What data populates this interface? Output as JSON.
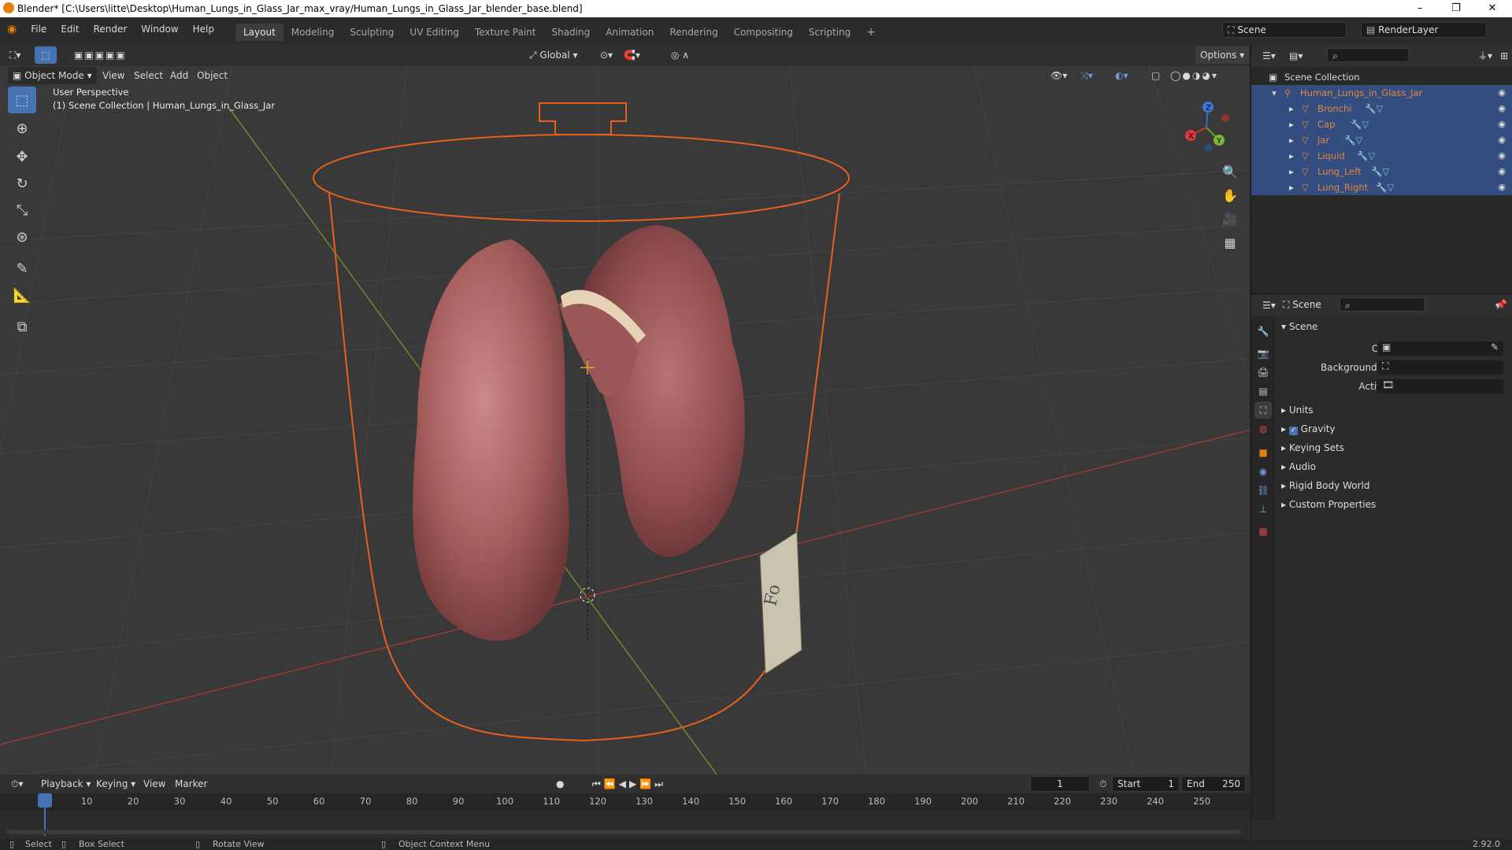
{
  "window": {
    "title": "Blender* [C:\\Users\\litte\\Desktop\\Human_Lungs_in_Glass_Jar_max_vray/Human_Lungs_in_Glass_Jar_blender_base.blend]",
    "minimize": "–",
    "maximize": "❐",
    "close": "✕"
  },
  "menu": {
    "items": [
      "File",
      "Edit",
      "Render",
      "Window",
      "Help"
    ],
    "workspaces": [
      "Layout",
      "Modeling",
      "Sculpting",
      "UV Editing",
      "Texture Paint",
      "Shading",
      "Animation",
      "Rendering",
      "Compositing",
      "Scripting"
    ],
    "add_workspace": "+",
    "scene_name": "Scene",
    "render_layer": "RenderLayer"
  },
  "viewport": {
    "mode": "Object Mode",
    "header_menus": [
      "View",
      "Select",
      "Add",
      "Object"
    ],
    "transform_orientation": "Global",
    "options_label": "Options",
    "overlay_line1": "User Perspective",
    "overlay_line2": "(1) Scene Collection | Human_Lungs_in_Glass_Jar",
    "gizmo_x": "X",
    "gizmo_y": "Y",
    "gizmo_z": "Z",
    "label_text": "Fo"
  },
  "outliner": {
    "root": "Scene Collection",
    "collection": "Human_Lungs_in_Glass_Jar",
    "objects": [
      "Bronchi",
      "Cap",
      "Jar",
      "Liquid",
      "Lung_Left",
      "Lung_Right"
    ]
  },
  "properties": {
    "context": "Scene",
    "panel": "Scene",
    "camera_label": "Camera",
    "background_label": "Background Scene",
    "clip_label": "Active Clip",
    "sections": [
      "Units",
      "Gravity",
      "Keying Sets",
      "Audio",
      "Rigid Body World",
      "Custom Properties"
    ],
    "gravity_checked": true
  },
  "timeline": {
    "menus": [
      "Playback",
      "Keying",
      "View",
      "Marker"
    ],
    "current_frame": "1",
    "start_label": "Start",
    "start_value": "1",
    "end_label": "End",
    "end_value": "250",
    "ticks": [
      "1",
      "10",
      "20",
      "30",
      "40",
      "50",
      "60",
      "70",
      "80",
      "90",
      "100",
      "110",
      "120",
      "130",
      "140",
      "150",
      "160",
      "170",
      "180",
      "190",
      "200",
      "210",
      "220",
      "230",
      "240",
      "250"
    ]
  },
  "statusbar": {
    "select": "Select",
    "box_select": "Box Select",
    "rotate_view": "Rotate View",
    "context_menu": "Object Context Menu",
    "version": "2.92.0"
  },
  "colors": {
    "selection_orange": "#e8601c",
    "active_blue": "#4772b3",
    "outliner_selected": "#334d80"
  }
}
